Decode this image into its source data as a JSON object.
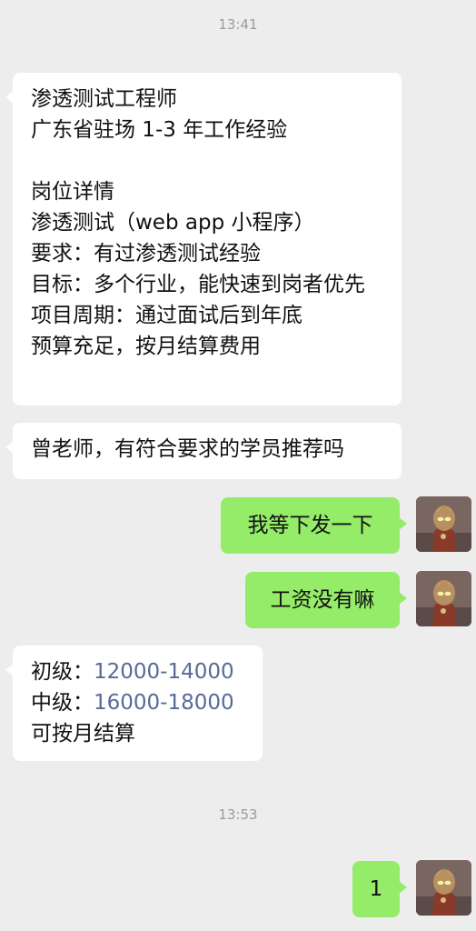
{
  "timestamps": {
    "first": "13:41",
    "second": "13:53"
  },
  "messages": {
    "job_post": {
      "lines": [
        "渗透测试工程师",
        "广东省驻场  1-3 年工作经验",
        "",
        "岗位详情",
        "渗透测试（web app 小程序）",
        "要求：有过渗透测试经验",
        "目标：多个行业，能快速到岗者优先",
        "项目周期：通过面试后到年底",
        "预算充足，按月结算费用"
      ]
    },
    "recommend_request": "曾老师，有符合要求的学员推荐吗",
    "reply_later": "我等下发一下",
    "salary_question": "工资没有嘛",
    "salary_info": {
      "junior_label": "初级：",
      "junior_value": "12000-14000",
      "mid_label": "中级：",
      "mid_value": "16000-18000",
      "note": "可按月结算"
    },
    "final_reply": "1"
  },
  "colors": {
    "background": "#ededed",
    "incoming_bubble": "#ffffff",
    "outgoing_bubble": "#95ec69",
    "link": "#576b95",
    "timestamp": "#9b9b9b"
  },
  "icons": {
    "avatar": "avatar-image"
  }
}
